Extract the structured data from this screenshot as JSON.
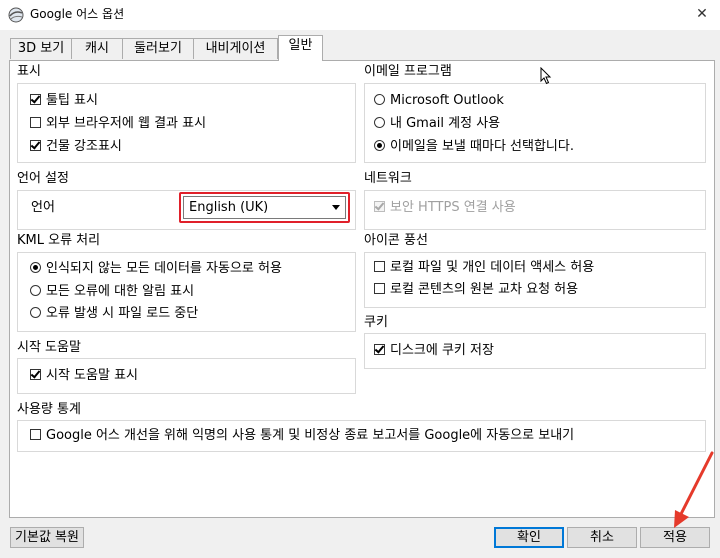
{
  "window": {
    "title": "Google 어스 옵션",
    "close_glyph": "✕",
    "app_icon": "google-earth-icon"
  },
  "tabs": [
    {
      "label": "3D 보기",
      "active": false
    },
    {
      "label": "캐시",
      "active": false
    },
    {
      "label": "둘러보기",
      "active": false
    },
    {
      "label": "내비게이션",
      "active": false
    },
    {
      "label": "일반",
      "active": true
    }
  ],
  "display": {
    "title": "표시",
    "items": [
      {
        "label": "툴팁 표시",
        "checked": true
      },
      {
        "label": "외부 브라우저에 웹 결과 표시",
        "checked": false
      },
      {
        "label": "건물 강조표시",
        "checked": true
      }
    ]
  },
  "language": {
    "title": "언어 설정",
    "label": "언어",
    "selected": "English (UK)"
  },
  "kml": {
    "title": "KML 오류 처리",
    "options": [
      {
        "label": "인식되지 않는 모든 데이터를 자동으로 허용",
        "checked": true
      },
      {
        "label": "모든 오류에 대한 알림 표시",
        "checked": false
      },
      {
        "label": "오류 발생 시 파일 로드 중단",
        "checked": false
      }
    ]
  },
  "startup": {
    "title": "시작 도움말",
    "item": {
      "label": "시작 도움말 표시",
      "checked": true
    }
  },
  "usage": {
    "title": "사용량 통계",
    "item": {
      "label": "Google 어스 개선을 위해 익명의 사용 통계 및 비정상 종료 보고서를 Google에 자동으로 보내기",
      "checked": false
    }
  },
  "email": {
    "title": "이메일 프로그램",
    "options": [
      {
        "label": "Microsoft Outlook",
        "checked": false
      },
      {
        "label": "내 Gmail 계정 사용",
        "checked": false
      },
      {
        "label": "이메일을 보낼 때마다 선택합니다.",
        "checked": true
      }
    ]
  },
  "network": {
    "title": "네트워크",
    "item": {
      "label": "보안 HTTPS 연결 사용",
      "checked": true,
      "disabled": true
    }
  },
  "icon_balloon": {
    "title": "아이콘 풍선",
    "items": [
      {
        "label": "로컬 파일 및 개인 데이터 액세스 허용",
        "checked": false
      },
      {
        "label": "로컬 콘텐츠의 원본 교차 요청 허용",
        "checked": false
      }
    ]
  },
  "cookies": {
    "title": "쿠키",
    "item": {
      "label": "디스크에 쿠키 저장",
      "checked": true
    }
  },
  "buttons": {
    "restore": "기본값 복원",
    "ok": "확인",
    "cancel": "취소",
    "apply": "적용"
  },
  "colors": {
    "highlight_box": "#e0202a",
    "annotation_arrow": "#e53a2b",
    "default_button": "#0078d7"
  }
}
